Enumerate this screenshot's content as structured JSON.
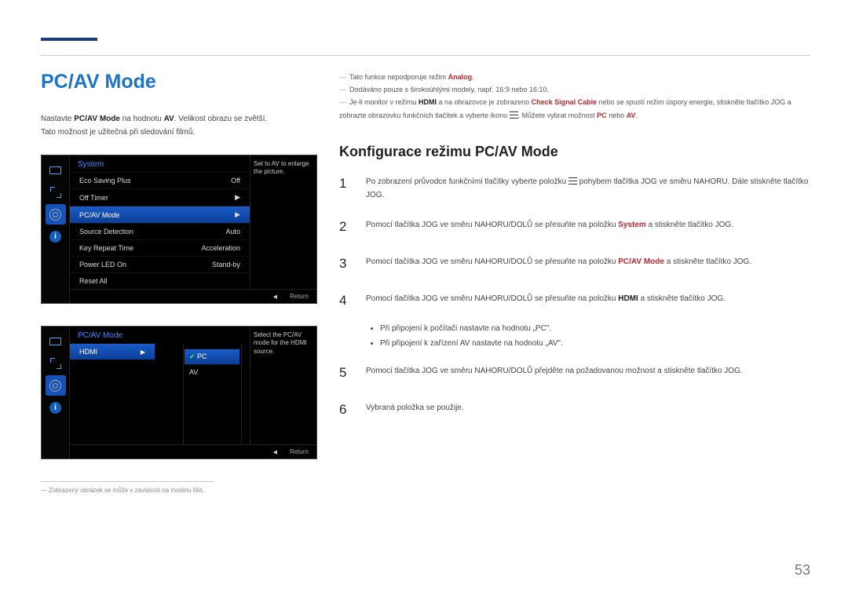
{
  "header": {
    "title": "PC/AV Mode"
  },
  "intro": {
    "line1_a": "Nastavte ",
    "line1_b": "PC/AV Mode",
    "line1_c": " na hodnotu ",
    "line1_d": "AV",
    "line1_e": ". Velikost obrazu se zvětší.",
    "line2": "Tato možnost je užitečná při sledování filmů."
  },
  "osd1": {
    "title": "System",
    "hint": "Set to AV to enlarge the picture.",
    "rows": [
      {
        "label": "Eco Saving Plus",
        "value": "Off"
      },
      {
        "label": "Off Timer",
        "value": "▶"
      },
      {
        "label": "PC/AV Mode",
        "value": "▶"
      },
      {
        "label": "Source Detection",
        "value": "Auto"
      },
      {
        "label": "Key Repeat Time",
        "value": "Acceleration"
      },
      {
        "label": "Power LED On",
        "value": "Stand-by"
      },
      {
        "label": "Reset All",
        "value": ""
      }
    ],
    "footer_return": "Return"
  },
  "osd2": {
    "title": "PC/AV Mode",
    "hint": "Select the PC/AV mode for the HDMI source.",
    "rows": [
      {
        "label": "HDMI",
        "value": ""
      }
    ],
    "options": [
      {
        "label": "PC",
        "selected": true
      },
      {
        "label": "AV",
        "selected": false
      }
    ],
    "footer_return": "Return"
  },
  "footnote": {
    "text": "Zobrazený obrázek se může v závislosti na modelu lišit."
  },
  "notes": {
    "n1_a": "Tato funkce nepodporuje režim ",
    "n1_b": "Analog",
    "n1_c": ".",
    "n2": "Dodáváno pouze s širokoúhlými modely, např. 16:9 nebo 16:10.",
    "n3_a": "Je-li monitor v režimu ",
    "n3_b": "HDMI",
    "n3_c": " a na obrazovce je zobrazeno ",
    "n3_d": "Check Signal Cable",
    "n3_e": " nebo se spustí režim úspory energie, stiskněte tlačítko JOG a zobrazte obrazovku funkčních tlačítek a vyberte ikonu ",
    "n3_f": ". Můžete vybrat možnost ",
    "n3_g": "PC",
    "n3_h": " nebo ",
    "n3_i": "AV",
    "n3_j": "."
  },
  "config": {
    "heading": "Konfigurace režimu PC/AV Mode",
    "step1_a": "Po zobrazení průvodce funkčními tlačítky vyberte položku ",
    "step1_b": " pohybem tlačítka JOG ve směru NAHORU. Dále stiskněte tlačítko JOG.",
    "step2_a": "Pomocí tlačítka JOG ve směru NAHORU/DOLŮ se přesuňte na položku ",
    "step2_b": "System",
    "step2_c": " a stiskněte tlačítko JOG.",
    "step3_a": "Pomocí tlačítka JOG ve směru NAHORU/DOLŮ se přesuňte na položku ",
    "step3_b": "PC/AV Mode",
    "step3_c": " a stiskněte tlačítko JOG.",
    "step4_a": "Pomocí tlačítka JOG ve směru NAHORU/DOLŮ se přesuňte na položku ",
    "step4_b": "HDMI",
    "step4_c": " a stiskněte tlačítko JOG.",
    "bullet1": "Při připojení k počítači nastavte na hodnotu „PC\".",
    "bullet2": "Při připojení k zařízení AV nastavte na hodnotu „AV\".",
    "step5": "Pomocí tlačítka JOG ve směru NAHORU/DOLŮ přejděte na požadovanou možnost a stiskněte tlačítko JOG.",
    "step6": "Vybraná položka se použije."
  },
  "page_number": "53"
}
